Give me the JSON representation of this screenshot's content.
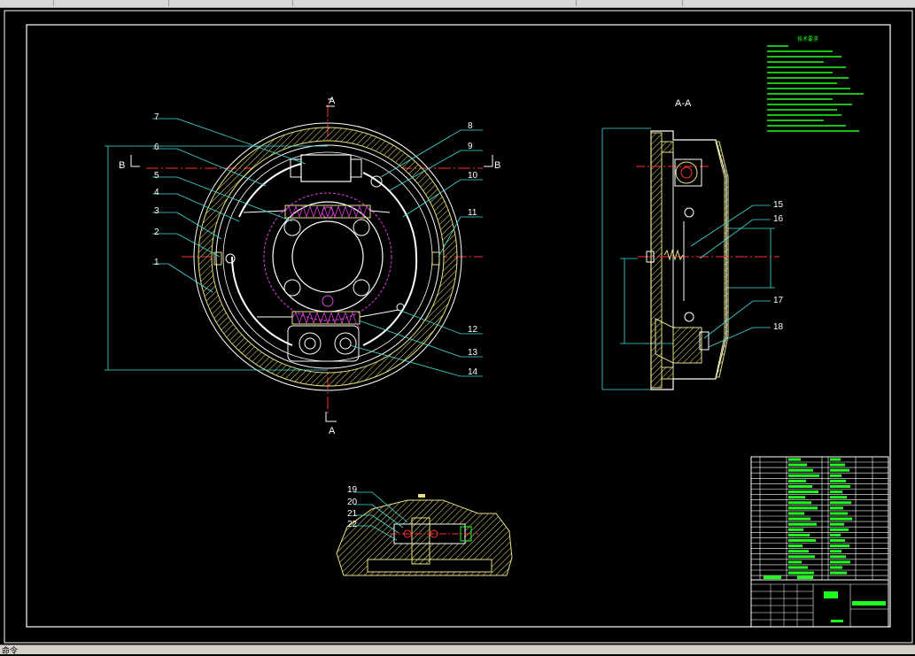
{
  "window": {
    "title_segments": [
      "",
      "",
      "",
      "",
      ""
    ],
    "command_line": "命令"
  },
  "drawing": {
    "section_marks": {
      "a_top": "A",
      "a_bottom": "A",
      "b_left": "B",
      "b_right": "B",
      "section_title": "A-A"
    },
    "part_labels": [
      "1",
      "2",
      "3",
      "4",
      "5",
      "6",
      "7",
      "8",
      "9",
      "10",
      "11",
      "12",
      "13",
      "14",
      "15",
      "16",
      "17",
      "18",
      "19",
      "20",
      "21",
      "22"
    ],
    "notes_title": "技术要求"
  },
  "colors": {
    "background": "#000000",
    "outline": "#ffffff",
    "drum": "#e8e080",
    "centerline": "#ff3030",
    "leader": "#40e0e0",
    "magenta": "#e040e0",
    "green_text": "#20ff20",
    "frame": "#ffffff"
  }
}
